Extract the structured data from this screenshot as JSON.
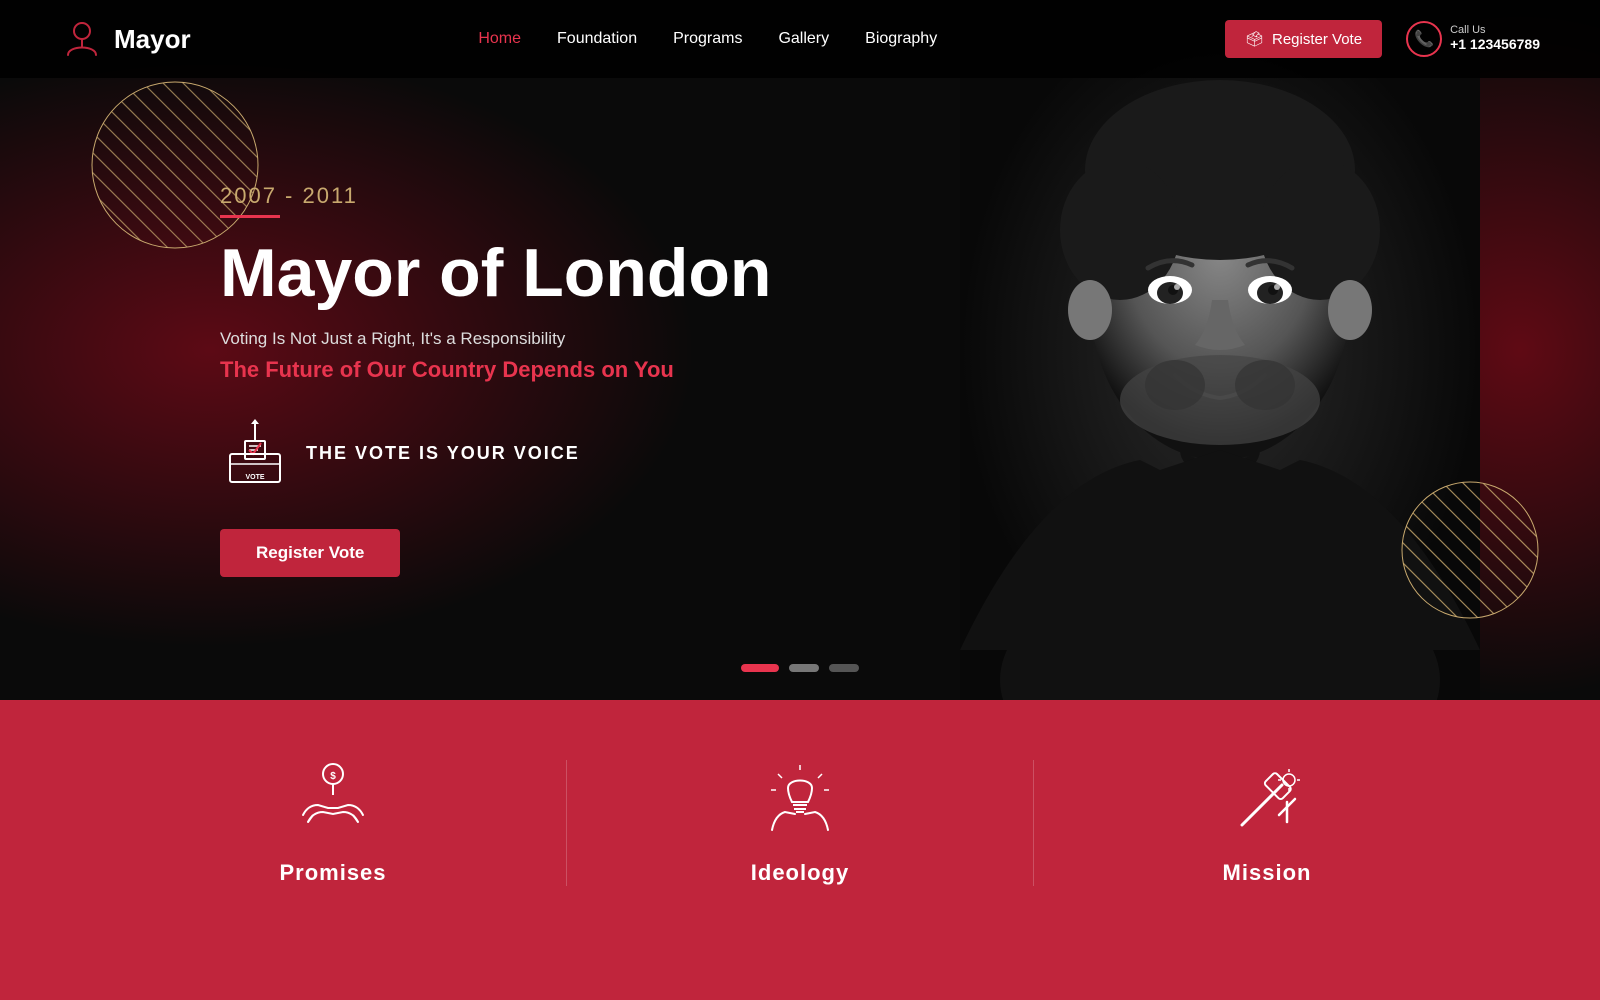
{
  "navbar": {
    "logo_text": "Mayor",
    "links": [
      {
        "label": "Home",
        "active": true
      },
      {
        "label": "Foundation",
        "active": false
      },
      {
        "label": "Programs",
        "active": false
      },
      {
        "label": "Gallery",
        "active": false
      },
      {
        "label": "Biography",
        "active": false
      }
    ],
    "register_btn": "Register Vote",
    "call_us_label": "Call Us",
    "phone": "+1 123456789"
  },
  "hero": {
    "year_range": "2007 - 2011",
    "title": "Mayor of London",
    "subtitle": "Voting Is Not Just a Right, It's a Responsibility",
    "tagline": "The Future of Our Country Depends on You",
    "vote_label": "THE VOTE IS YOUR VOICE",
    "register_btn": "Register Vote"
  },
  "slider": {
    "dots": [
      "active",
      "mid",
      "inactive"
    ]
  },
  "bottom": {
    "cards": [
      {
        "label": "Promises"
      },
      {
        "label": "Ideology"
      },
      {
        "label": "Mission"
      }
    ]
  }
}
